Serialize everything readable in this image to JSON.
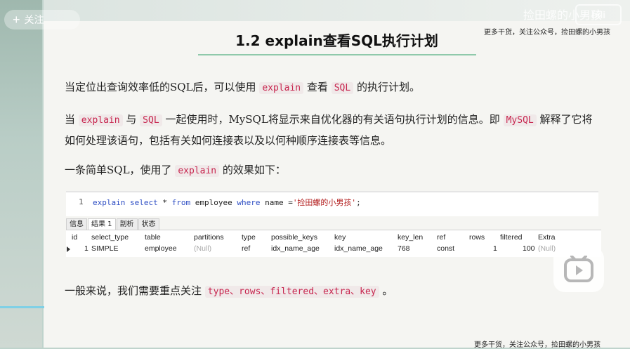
{
  "overlay": {
    "follow_label": "关注",
    "follow_icon": "plus-icon",
    "watermark_text": "捡田螺的小男孩",
    "logo_text": "bili",
    "promo_top": "更多干货，关注公众号，捡田螺的小男孩",
    "promo_bottom": "更多干货，关注公众号，捡田螺的小男孩",
    "play_icon": "play-icon",
    "progress": 0.07,
    "accent": "#7fd0e6"
  },
  "slide": {
    "title": "1.2 explain查看SQL执行计划",
    "title_rule_color": "#8fc9ab",
    "p1": {
      "t1": "当定位出查询效率低的SQL后，可以使用",
      "c1": "explain",
      "t2": "查看",
      "c2": "SQL",
      "t3": "的执行计划。"
    },
    "p2": {
      "t1": "当",
      "c1": "explain",
      "t2": "与",
      "c2": "SQL",
      "t3": "一起使用时，MySQL将显示来自优化器的有关语句执行计划的信息。即",
      "c3": "MySQL",
      "t4": "解释了它将如何处理该语句，包括有关如何连接表以及以何种顺序连接表等信息。"
    },
    "p3": {
      "t1": "一条简单SQL，使用了",
      "c1": "explain",
      "t2": "的效果如下："
    },
    "p4": {
      "t1": "一般来说，我们需要重点关注",
      "c1": "type、rows、filtered、extra、key",
      "t2": "。"
    }
  },
  "editor": {
    "line_number": "1",
    "kw1": "explain select",
    "t1": " * ",
    "kw2": "from",
    "t2": " employee ",
    "kw3": "where",
    "t3": " name =",
    "str": "'捡田螺的小男孩'",
    "t4": ";"
  },
  "tabs": [
    "信息",
    "结果 1",
    "剖析",
    "状态"
  ],
  "result": {
    "columns": [
      "id",
      "select_type",
      "table",
      "partitions",
      "type",
      "possible_keys",
      "key",
      "key_len",
      "ref",
      "rows",
      "filtered",
      "Extra"
    ],
    "row": [
      "1",
      "SIMPLE",
      "employee",
      "(Null)",
      "ref",
      "idx_name_age",
      "idx_name_age",
      "768",
      "const",
      "1",
      "100",
      "(Null)"
    ]
  }
}
